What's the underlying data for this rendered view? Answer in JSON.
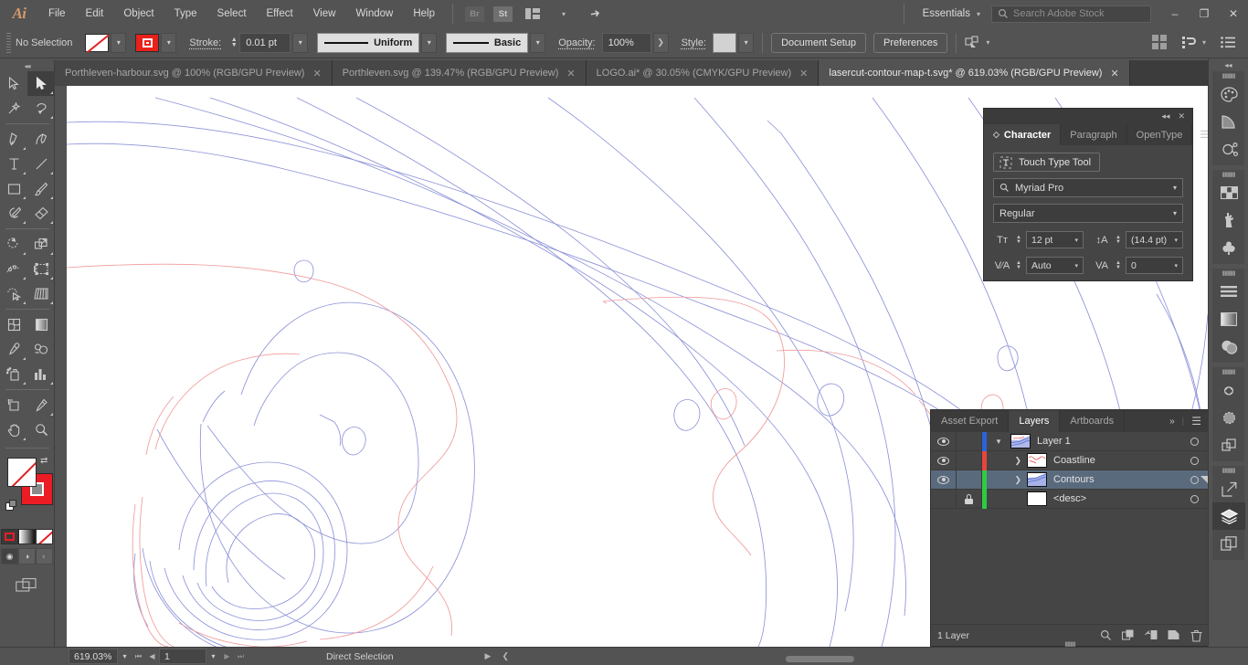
{
  "app": {
    "logo": "Ai",
    "menus": [
      "File",
      "Edit",
      "Object",
      "Type",
      "Select",
      "Effect",
      "View",
      "Window",
      "Help"
    ],
    "quick_icons": [
      "bridge-icon",
      "stock-icon",
      "arrange-documents-icon",
      "chevron-down-icon",
      "rocket-icon"
    ],
    "bridge_label": "Br",
    "stock_label": "St",
    "workspace": "Essentials",
    "search_placeholder": "Search Adobe Stock",
    "window_buttons": [
      "minimize",
      "restore",
      "close"
    ]
  },
  "control_bar": {
    "selection_status": "No Selection",
    "fill_label": "fill-swatch",
    "stroke_swatch_label": "stroke-swatch",
    "stroke_label": "Stroke:",
    "stroke_weight": "0.01 pt",
    "stroke_profile": "Uniform",
    "brush_definition": "Basic",
    "opacity_label": "Opacity:",
    "opacity_value": "100%",
    "style_label": "Style:",
    "document_setup": "Document Setup",
    "preferences": "Preferences",
    "right_icons": [
      "align-icon",
      "transform-icon",
      "chevron-down-icon",
      "menu-list-icon"
    ]
  },
  "tabs": [
    {
      "title": "Porthleven-harbour.svg @ 100% (RGB/GPU Preview)",
      "active": false
    },
    {
      "title": "Porthleven.svg @ 139.47% (RGB/GPU Preview)",
      "active": false
    },
    {
      "title": "LOGO.ai* @ 30.05% (CMYK/GPU Preview)",
      "active": false
    },
    {
      "title": "lasercut-contour-map-t.svg* @ 619.03% (RGB/GPU Preview)",
      "active": true
    }
  ],
  "toolbar": {
    "tools": [
      [
        "selection-tool",
        "direct-selection-tool"
      ],
      [
        "magic-wand-tool",
        "lasso-tool"
      ],
      [
        "pen-tool",
        "curvature-tool"
      ],
      [
        "type-tool",
        "line-segment-tool"
      ],
      [
        "rectangle-tool",
        "paintbrush-tool"
      ],
      [
        "shaper-tool",
        "eraser-tool"
      ],
      [
        "rotate-tool",
        "scale-tool"
      ],
      [
        "width-tool",
        "free-transform-tool"
      ],
      [
        "shape-builder-tool",
        "perspective-grid-tool"
      ],
      [
        "mesh-tool",
        "gradient-tool"
      ],
      [
        "eyedropper-tool",
        "blend-tool"
      ],
      [
        "symbol-sprayer-tool",
        "column-graph-tool"
      ],
      [
        "artboard-tool",
        "slice-tool"
      ],
      [
        "hand-tool",
        "zoom-tool"
      ]
    ],
    "selected_tool": "direct-selection-tool",
    "fill_color": "#ffffff",
    "stroke_color": "#ec1c24",
    "color_modes": [
      "color-swatch-mode",
      "gradient-mode",
      "none-mode"
    ],
    "draw_modes": [
      "draw-normal",
      "draw-behind",
      "draw-inside"
    ],
    "screen_mode": "change-screen-mode"
  },
  "character_panel": {
    "tabs": [
      {
        "label": "Character",
        "active": true
      },
      {
        "label": "Paragraph",
        "active": false
      },
      {
        "label": "OpenType",
        "active": false
      }
    ],
    "touch_type_tool": "Touch Type Tool",
    "font_family": "Myriad Pro",
    "font_style": "Regular",
    "font_size": "12 pt",
    "leading": "(14.4 pt)",
    "kerning": "Auto",
    "tracking": "0"
  },
  "layers_panel": {
    "tabs": [
      {
        "label": "Asset Export",
        "active": false
      },
      {
        "label": "Layers",
        "active": true
      },
      {
        "label": "Artboards",
        "active": false
      }
    ],
    "rows": [
      {
        "name": "Layer 1",
        "visible": true,
        "locked": false,
        "color": "#2b63d8",
        "indent": 0,
        "twisty": "down",
        "selected": false,
        "thumb": "map-thumb",
        "target": true
      },
      {
        "name": "Coastline",
        "visible": true,
        "locked": false,
        "color": "#e8453c",
        "indent": 1,
        "twisty": "right",
        "selected": false,
        "thumb": "coastline-thumb",
        "target": true
      },
      {
        "name": "Contours",
        "visible": true,
        "locked": false,
        "color": "#2ecc40",
        "indent": 1,
        "twisty": "right",
        "selected": true,
        "thumb": "contours-thumb",
        "target": true
      },
      {
        "name": "<desc>",
        "visible": false,
        "locked": true,
        "color": "#2ecc40",
        "indent": 1,
        "twisty": "",
        "selected": false,
        "thumb": "blank-thumb",
        "target": true
      }
    ],
    "footer_count": "1 Layer",
    "footer_icons": [
      "locate-object-icon",
      "make-clipping-mask-icon",
      "create-new-sublayer-icon",
      "create-new-layer-icon",
      "delete-selection-icon"
    ]
  },
  "rail": {
    "groups": [
      [
        "color-panel-icon",
        "color-guide-icon",
        "color-themes-icon"
      ],
      [
        "swatches-panel-icon",
        "brushes-panel-icon",
        "symbols-panel-icon"
      ],
      [
        "align-panel-icon",
        "gradient-panel-icon",
        "transparency-panel-icon"
      ],
      [
        "libraries-panel-icon",
        "appearance-panel-icon",
        "pathfinder-panel-icon"
      ],
      [
        "asset-export-icon",
        "layers-panel-icon",
        "artboards-panel-icon"
      ]
    ],
    "active": "layers-panel-icon"
  },
  "status_bar": {
    "zoom": "619.03%",
    "page": "1",
    "status_text": "Direct Selection",
    "nav_icons": [
      "first-artboard",
      "previous-artboard",
      "next-artboard",
      "last-artboard"
    ]
  },
  "artwork": {
    "coastline_color": "#f09a9a",
    "contour_color": "#8d93d8",
    "background": "#ffffff"
  }
}
